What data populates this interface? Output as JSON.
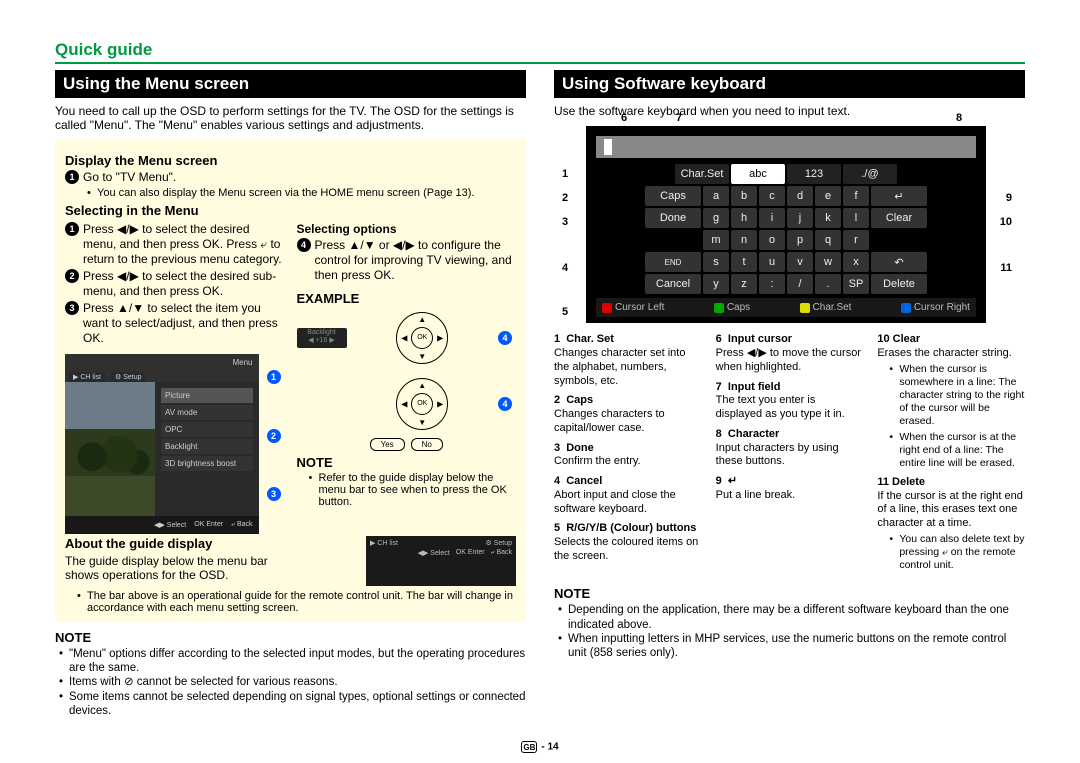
{
  "header": {
    "quick_guide": "Quick guide"
  },
  "left": {
    "title": "Using the Menu screen",
    "intro": "You need to call up the OSD to perform settings for the TV. The OSD for the settings is called \"Menu\". The \"Menu\" enables various settings and adjustments.",
    "display_h": "Display the Menu screen",
    "display_step1": "Go to \"TV Menu\".",
    "display_note": "You can also display the Menu screen via the HOME menu screen (Page 13).",
    "selecting_h": "Selecting in the Menu",
    "sel_step1": "Press ◀/▶ to select the desired menu, and then press OK. Press ⤶ to return to the previous menu category.",
    "sel_step2": "Press ◀/▶ to select the desired sub-menu, and then press OK.",
    "sel_step3": "Press ▲/▼ to select the item you want to select/adjust, and then press OK.",
    "sel_opt_h": "Selecting options",
    "sel_step4": "Press ▲/▼ or ◀/▶ to configure the control for improving TV viewing, and then press OK.",
    "example_h": "EXAMPLE",
    "example_note_h": "NOTE",
    "example_note": "Refer to the guide display below the menu bar to see when to press the OK button.",
    "about_h": "About the guide display",
    "about_p": "The guide display below the menu bar shows operations for the OSD.",
    "about_note": "The bar above is an operational guide for the remote control unit. The bar will change in accordance with each menu setting screen.",
    "menu_shot": {
      "top_label": "Menu",
      "tab1": "CH list",
      "tab2": "Setup",
      "items": [
        "Picture",
        "AV mode",
        "OPC",
        "Backlight",
        "3D brightness boost"
      ],
      "bot_select": "Select",
      "bot_enter": "Enter",
      "bot_back": "Back"
    },
    "yesno": {
      "yes": "Yes",
      "no": "No"
    },
    "guidebar": {
      "ch": "CH list",
      "setup": "Setup",
      "sel": "Select",
      "ent": "Enter",
      "back": "Back"
    },
    "note_h": "NOTE",
    "note1": "\"Menu\" options differ according to the selected input modes, but the operating procedures are the same.",
    "note2": "Items with ⊘ cannot be selected for various reasons.",
    "note3": "Some items cannot be selected depending on signal types, optional settings or connected devices."
  },
  "right": {
    "title": "Using Software keyboard",
    "intro": "Use the software keyboard when you need to input text.",
    "kbd": {
      "tabs": {
        "charset": "Char.Set",
        "abc": "abc",
        "123": "123",
        "sym": "./@"
      },
      "rows_letters": [
        [
          "a",
          "b",
          "c",
          "d",
          "e",
          "f"
        ],
        [
          "g",
          "h",
          "i",
          "j",
          "k",
          "l"
        ],
        [
          "m",
          "n",
          "o",
          "p",
          "q",
          "r"
        ],
        [
          "s",
          "t",
          "u",
          "v",
          "w",
          "x"
        ],
        [
          "y",
          "z",
          ":",
          "/",
          ".",
          "SP"
        ]
      ],
      "caps": "Caps",
      "done": "Done",
      "end": "END",
      "cancel": "Cancel",
      "enter": "↵",
      "clear": "Clear",
      "back": "↶",
      "delete": "Delete",
      "bottom": {
        "r": "Cursor Left",
        "g": "Caps",
        "y": "Char.Set",
        "b": "Cursor Right"
      }
    },
    "ptr": {
      "p1": "1",
      "p2": "2",
      "p3": "3",
      "p4": "4",
      "p5": "5",
      "p6": "6",
      "p7": "7",
      "p8": "8",
      "p9": "9",
      "p10": "10",
      "p11": "11"
    },
    "legend": {
      "i1t": "Char. Set",
      "i1d": "Changes character set into the alphabet, numbers, symbols, etc.",
      "i2t": "Caps",
      "i2d": "Changes characters to capital/lower case.",
      "i3t": "Done",
      "i3d": "Confirm the entry.",
      "i4t": "Cancel",
      "i4d": "Abort input and close the software keyboard.",
      "i5t": "R/G/Y/B (Colour) buttons",
      "i5d": "Selects the coloured items on the screen.",
      "i6t": "Input cursor",
      "i6d": "Press ◀/▶ to move the cursor when highlighted.",
      "i7t": "Input field",
      "i7d": "The text you enter is displayed as you type it in.",
      "i8t": "Character",
      "i8d": "Input characters by using these buttons.",
      "i9t": "↵",
      "i9d": "Put a line break.",
      "i10t": "Clear",
      "i10d": "Erases the character string.",
      "i10b1": "When the cursor is somewhere in a line: The character string to the right of the cursor will be erased.",
      "i10b2": "When the cursor is at the right end of a line: The entire line will be erased.",
      "i11t": "Delete",
      "i11d": "If the cursor is at the right end of a line, this erases text one character at a time.",
      "i11b": "You can also delete text by pressing ⤶ on the remote control unit."
    },
    "note_h": "NOTE",
    "note1": "Depending on the application, there may be a different software keyboard than the one indicated above.",
    "note2": "When inputting letters in MHP services, use the numeric buttons on the remote control unit (858 series only)."
  },
  "footer": {
    "region": "GB",
    "page": "- 14"
  }
}
